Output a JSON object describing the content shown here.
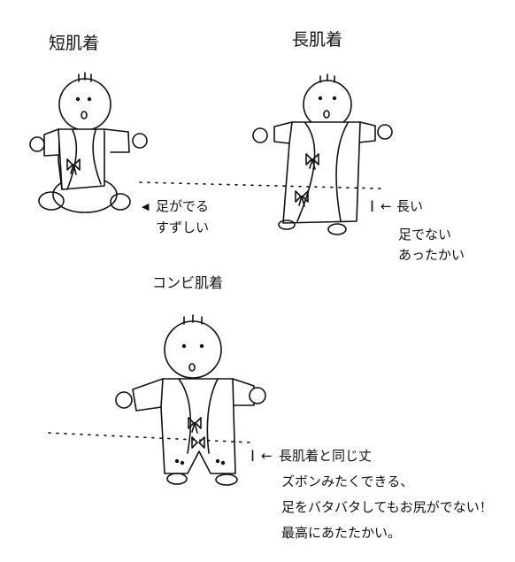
{
  "short_undershirt": {
    "title": "短肌着",
    "note_line1": "足がでる",
    "note_line2": "すずしい"
  },
  "long_undershirt": {
    "title": "長肌着",
    "note_line1": "長い",
    "note_line2": "足でない",
    "note_line3": "あったかい"
  },
  "combination_undershirt": {
    "title": "コンビ肌着",
    "note_line1": "長肌着と同じ丈",
    "note_line2": "ズボンみたくできる、",
    "note_line3": "足をバタバタしてもお尻がでない！",
    "note_line4": "最高にあたたかい。"
  },
  "symbols": {
    "arrow": "◀",
    "left_arrow": "←",
    "length_marker": "I"
  }
}
